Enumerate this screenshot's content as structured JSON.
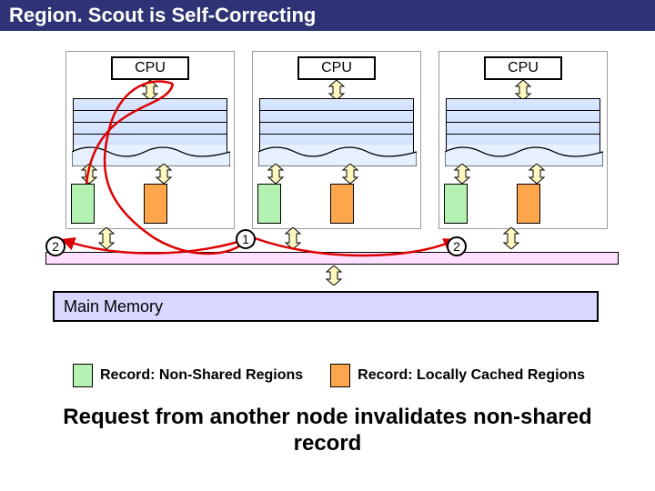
{
  "title": "Region. Scout is Self-Correcting",
  "cpu_label": "CPU",
  "main_memory_label": "Main Memory",
  "badge_left": "2",
  "badge_mid": "1",
  "badge_right": "2",
  "legend": {
    "nonshared": "Record: Non-Shared Regions",
    "locally_cached": "Record: Locally Cached Regions"
  },
  "caption": "Request from another node invalidates non-shared record"
}
